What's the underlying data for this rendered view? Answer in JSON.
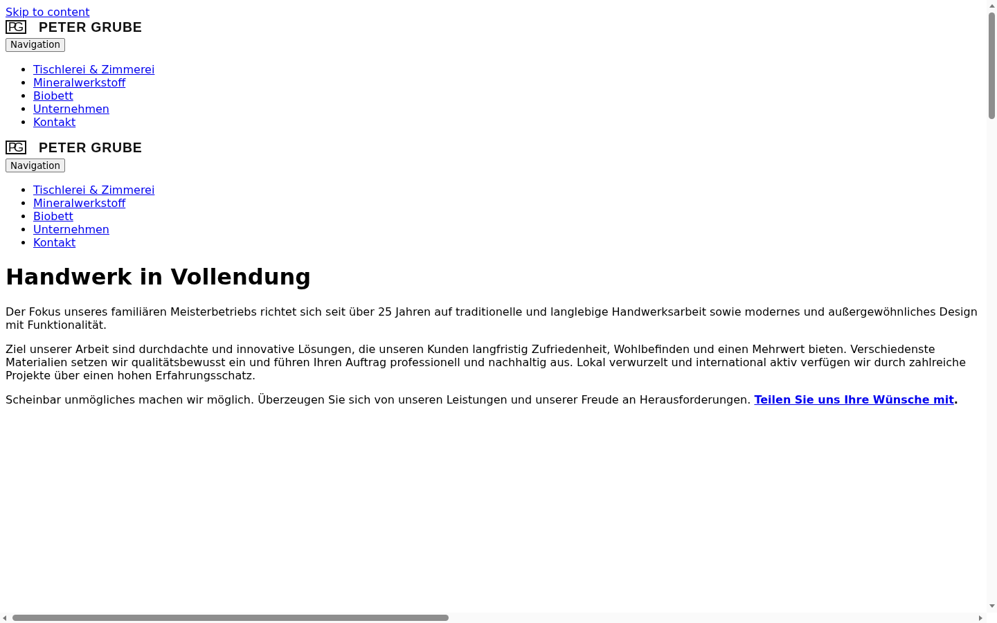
{
  "skip_link": {
    "label": "Skip to content"
  },
  "headers": [
    {
      "logo": {
        "monogram": "PG",
        "wordmark": "PETER GRUBE"
      },
      "nav_button": {
        "label": "Navigation"
      },
      "nav_items": [
        "Tischlerei & Zimmerei",
        "Mineralwerkstoff",
        "Biobett",
        "Unternehmen",
        "Kontakt"
      ]
    },
    {
      "logo": {
        "monogram": "PG",
        "wordmark": "PETER GRUBE"
      },
      "nav_button": {
        "label": "Navigation"
      },
      "nav_items": [
        "Tischlerei & Zimmerei",
        "Mineralwerkstoff",
        "Biobett",
        "Unternehmen",
        "Kontakt"
      ]
    }
  ],
  "main": {
    "heading": "Handwerk in Vollendung",
    "paragraphs": [
      {
        "text": "Der Fokus unseres familiären Meisterbetriebs richtet sich seit über 25 Jahren auf traditionelle und langlebige Handwerksarbeit sowie modernes und außergewöhnliches Design mit Funktionalität."
      },
      {
        "text": "Ziel unserer Arbeit sind durchdachte und innovative Lösungen, die unseren Kunden langfristig Zufriedenheit, Wohlbefinden und einen Mehrwert bieten. Verschiedenste Materialien setzen wir qualitätsbewusst ein und führen Ihren Auftrag professionell und nachhaltig aus. Lokal verwurzelt und international aktiv verfügen wir durch zahlreiche Projekte über einen hohen Erfahrungsschatz."
      },
      {
        "text": "Scheinbar unmögliches machen wir möglich. Überzeugen Sie sich von unseren Leistungen und unserer Freude an Herausforderungen.",
        "link": "Teilen Sie uns Ihre Wünsche mit",
        "after": "."
      }
    ]
  }
}
